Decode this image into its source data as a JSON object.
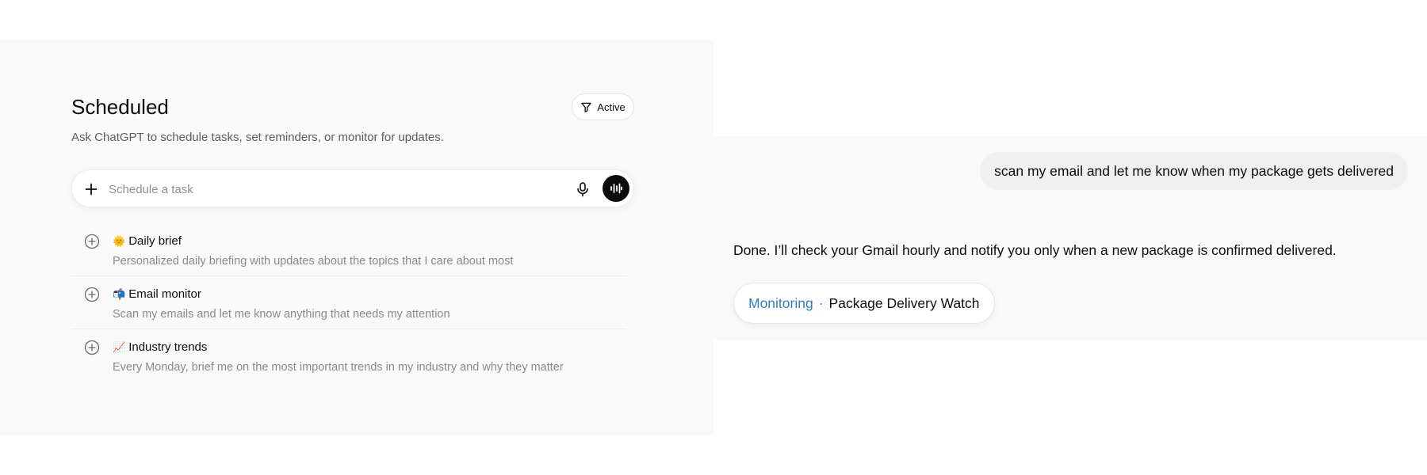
{
  "scheduled": {
    "title": "Scheduled",
    "filter_label": "Active",
    "subtitle": "Ask ChatGPT to schedule tasks, set reminders, or monitor for updates.",
    "composer": {
      "placeholder": "Schedule a task",
      "value": ""
    },
    "tasks": [
      {
        "emoji": "🌞",
        "title": "Daily brief",
        "description": "Personalized daily briefing with updates about the topics that I care about most"
      },
      {
        "emoji": "📬",
        "title": "Email monitor",
        "description": "Scan my emails and let me know anything that needs my attention"
      },
      {
        "emoji": "📈",
        "title": "Industry trends",
        "description": "Every Monday, brief me on the most important trends in my industry and why they matter"
      }
    ]
  },
  "chat": {
    "user_message": "scan my email and let me know when my package gets delivered",
    "assistant_message": "Done. I’ll check your Gmail hourly and notify you only when a new package is confirmed delivered.",
    "chip": {
      "status": "Monitoring",
      "separator": "·",
      "name": "Package Delivery Watch"
    }
  },
  "colors": {
    "accent_blue": "#2f7ccd",
    "panel_bg": "#f9f9f9",
    "muted_text": "#8a8a8a"
  },
  "icons": [
    "filter-icon",
    "plus-icon",
    "microphone-icon",
    "voice-mode-icon",
    "add-circle-icon"
  ]
}
